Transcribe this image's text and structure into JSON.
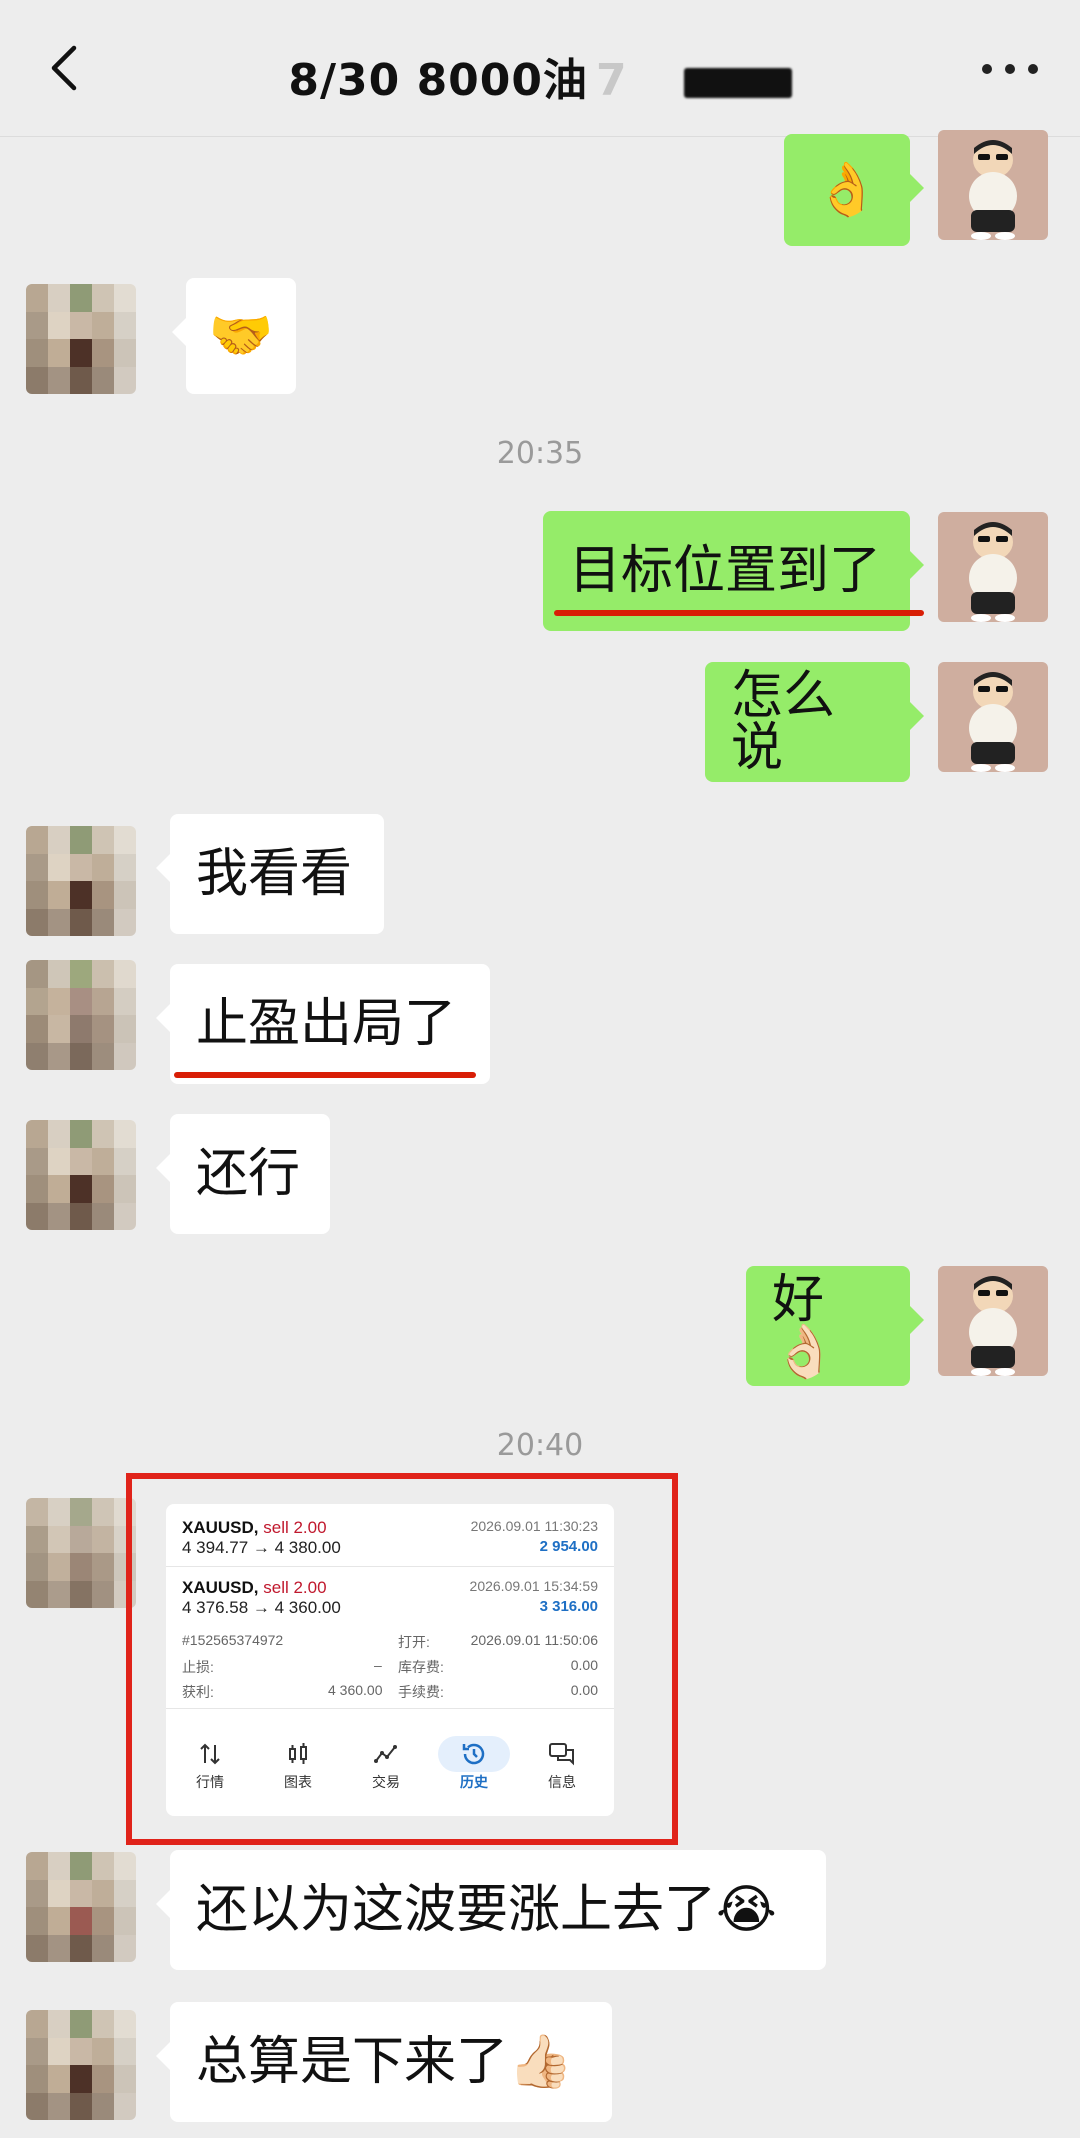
{
  "header": {
    "title": "8/30  8000油",
    "title_tail": "7",
    "back_icon": "chevron-left-icon",
    "more_icon": "more-dots-icon"
  },
  "messages": {
    "m1": "👌",
    "m2": "🤝",
    "time1": "20:35",
    "m3": "目标位置到了",
    "m4": "怎么说",
    "m5": "我看看",
    "m6": "止盈出局了",
    "m7": "还行",
    "m8": "好👌🏻",
    "time2": "20:40",
    "m9": "还以为这波要涨上去了😭",
    "m10": "总算是下来了👍🏻"
  },
  "trade_screenshot": {
    "trade1": {
      "symbol": "XAUUSD,",
      "side": "sell 2.00",
      "prices": "4 394.77 → 4 380.00",
      "date": "2026.09.01 11:30:23",
      "profit": "2 954.00"
    },
    "trade2": {
      "symbol": "XAUUSD,",
      "side": "sell 2.00",
      "prices": "4 376.58 → 4 360.00",
      "date": "2026.09.01 15:34:59",
      "profit": "3 316.00"
    },
    "details": {
      "order_id": "#152565374972",
      "open_label": "打开:",
      "open_value": "2026.09.01 11:50:06",
      "sl_label": "止损:",
      "sl_value": "–",
      "swap_label": "库存费:",
      "swap_value": "0.00",
      "tp_label": "获利:",
      "tp_value": "4 360.00",
      "fee_label": "手续费:",
      "fee_value": "0.00"
    },
    "nav": [
      "行情",
      "图表",
      "交易",
      "历史",
      "信息"
    ],
    "active_tab": "历史",
    "colors": {
      "sell": "#c0182d",
      "profit": "#1e6fc4",
      "highlight": "#e0231a"
    }
  },
  "colors": {
    "my_bubble": "#95ec69",
    "their_bubble": "#ffffff",
    "underline": "#d81e06",
    "background": "#ededed"
  }
}
